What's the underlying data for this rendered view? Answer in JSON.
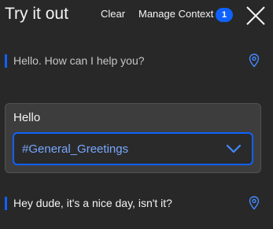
{
  "header": {
    "title": "Try it out",
    "clear_label": "Clear",
    "manage_context_label": "Manage Context",
    "context_count": "1",
    "close_icon": "close-icon"
  },
  "conversation": {
    "bot_message": "Hello. How can I help you?",
    "intent_card": {
      "label": "Hello",
      "selected_intent": "#General_Greetings",
      "dropdown_icon": "chevron-down-icon"
    },
    "user_message": "Hey dude, it's a nice day, isn't it?",
    "location_icon": "location-pin-icon"
  },
  "colors": {
    "background": "#282828",
    "accent": "#0f62fe",
    "intent_text": "#78a9ff",
    "card_background": "#3d3d3d"
  }
}
